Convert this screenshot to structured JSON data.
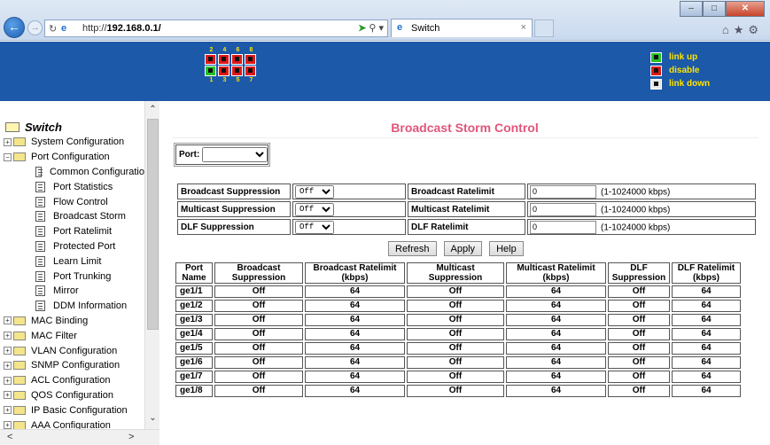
{
  "browser": {
    "url_prefix": "http://",
    "url_host": "192.168.0.1/",
    "tab_title": "Switch",
    "tab_close": "×",
    "window_controls": {
      "minimize": "–",
      "maximize": "□",
      "close": "✕"
    }
  },
  "banner": {
    "top_port_numbers": [
      "2",
      "4",
      "6",
      "8"
    ],
    "bottom_port_numbers": [
      "1",
      "3",
      "5",
      "7"
    ],
    "top_ports_status": [
      "disable",
      "disable",
      "disable",
      "disable"
    ],
    "bottom_ports_status": [
      "link-up",
      "disable",
      "disable",
      "disable"
    ],
    "legend": [
      {
        "label": "link up",
        "color": "#24c324"
      },
      {
        "label": "disable",
        "color": "#e01818"
      },
      {
        "label": "link down",
        "color": "#e8e8e8"
      }
    ]
  },
  "sidebar": {
    "root": "Switch",
    "items": [
      {
        "label": "System Configuration",
        "level": 1,
        "expander": "+"
      },
      {
        "label": "Port Configuration",
        "level": 1,
        "expander": "−"
      },
      {
        "label": "Common Configuratio",
        "level": 2
      },
      {
        "label": "Port Statistics",
        "level": 2
      },
      {
        "label": "Flow Control",
        "level": 2
      },
      {
        "label": "Broadcast Storm",
        "level": 2
      },
      {
        "label": "Port Ratelimit",
        "level": 2
      },
      {
        "label": "Protected Port",
        "level": 2
      },
      {
        "label": "Learn Limit",
        "level": 2
      },
      {
        "label": "Port Trunking",
        "level": 2
      },
      {
        "label": "Mirror",
        "level": 2
      },
      {
        "label": "DDM Information",
        "level": 2
      },
      {
        "label": "MAC Binding",
        "level": 1,
        "expander": "+"
      },
      {
        "label": "MAC Filter",
        "level": 1,
        "expander": "+"
      },
      {
        "label": "VLAN Configuration",
        "level": 1,
        "expander": "+"
      },
      {
        "label": "SNMP Configuration",
        "level": 1,
        "expander": "+"
      },
      {
        "label": "ACL Configuration",
        "level": 1,
        "expander": "+"
      },
      {
        "label": "QOS Configuration",
        "level": 1,
        "expander": "+"
      },
      {
        "label": "IP Basic Configuration",
        "level": 1,
        "expander": "+"
      },
      {
        "label": "AAA Configuration",
        "level": 1,
        "expander": "+"
      }
    ]
  },
  "main": {
    "title": "Broadcast Storm Control",
    "port_label": "Port:",
    "port_value": "",
    "config_rows": [
      {
        "name": "Broadcast Suppression",
        "state": "Off",
        "rate_label": "Broadcast Ratelimit",
        "rate_value": "0",
        "range": "(1-1024000 kbps)"
      },
      {
        "name": "Multicast Suppression",
        "state": "Off",
        "rate_label": "Multicast Ratelimit",
        "rate_value": "0",
        "range": "(1-1024000 kbps)"
      },
      {
        "name": "DLF Suppression",
        "state": "Off",
        "rate_label": "DLF Ratelimit",
        "rate_value": "0",
        "range": "(1-1024000 kbps)"
      }
    ],
    "buttons": {
      "refresh": "Refresh",
      "apply": "Apply",
      "help": "Help"
    },
    "table": {
      "headers": [
        [
          "Port",
          "Name"
        ],
        [
          "Broadcast",
          "Suppression"
        ],
        [
          "Broadcast Ratelimit",
          "(kbps)"
        ],
        [
          "Multicast",
          "Suppression"
        ],
        [
          "Multicast Ratelimit",
          "(kbps)"
        ],
        [
          "DLF",
          "Suppression"
        ],
        [
          "DLF Ratelimit",
          "(kbps)"
        ]
      ],
      "rows": [
        [
          "ge1/1",
          "Off",
          "64",
          "Off",
          "64",
          "Off",
          "64"
        ],
        [
          "ge1/2",
          "Off",
          "64",
          "Off",
          "64",
          "Off",
          "64"
        ],
        [
          "ge1/3",
          "Off",
          "64",
          "Off",
          "64",
          "Off",
          "64"
        ],
        [
          "ge1/4",
          "Off",
          "64",
          "Off",
          "64",
          "Off",
          "64"
        ],
        [
          "ge1/5",
          "Off",
          "64",
          "Off",
          "64",
          "Off",
          "64"
        ],
        [
          "ge1/6",
          "Off",
          "64",
          "Off",
          "64",
          "Off",
          "64"
        ],
        [
          "ge1/7",
          "Off",
          "64",
          "Off",
          "64",
          "Off",
          "64"
        ],
        [
          "ge1/8",
          "Off",
          "64",
          "Off",
          "64",
          "Off",
          "64"
        ]
      ]
    }
  }
}
